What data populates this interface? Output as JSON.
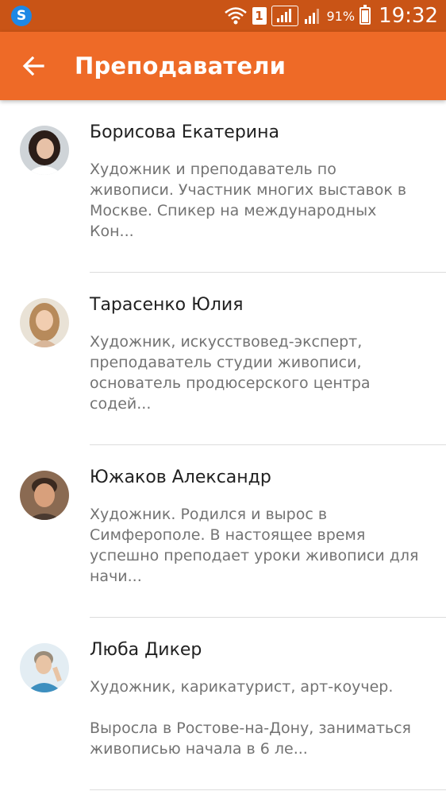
{
  "status_bar": {
    "app_icon_letter": "S",
    "sim_slot": "1",
    "battery_percent": "91%",
    "battery_level": 0.91,
    "time": "19:32",
    "colors": {
      "background": "#c95416"
    }
  },
  "header": {
    "title": "Преподаватели",
    "back_icon": "arrow-left-icon",
    "colors": {
      "background": "#ee6a27"
    }
  },
  "teachers": [
    {
      "name": "Борисова Екатерина",
      "description": "Художник и преподаватель по\nживописи. Участник многих выставок в\nМоскве. Спикер на международных\nКон..."
    },
    {
      "name": "Тарасенко Юлия",
      "description": "Художник, искусствовед-эксперт,\nпреподаватель студии живописи,\nоснователь продюсерского центра\nсодей..."
    },
    {
      "name": "Южаков Александр",
      "description": "Художник. Родился и вырос в\nСимферополе. В настоящее время\nуспешно преподает уроки живописи для\nначи..."
    },
    {
      "name": "Люба Дикер",
      "description": "Художник, карикатурист, арт-коучер.\n\nВыросла в Ростове-на-Дону, заниматься\nживописью начала в 6 ле..."
    }
  ]
}
